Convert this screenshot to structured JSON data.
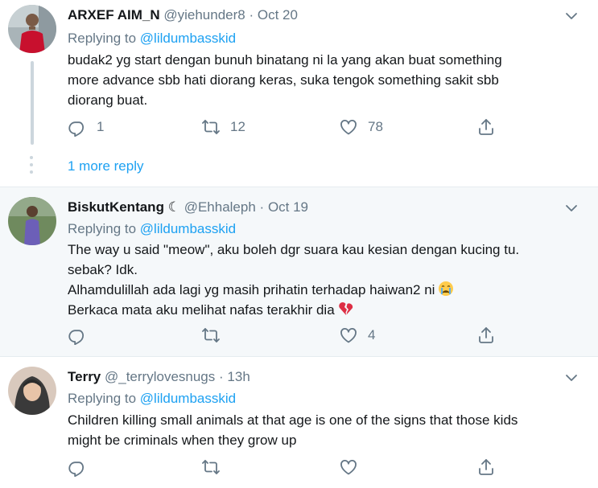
{
  "tweets": [
    {
      "name": "ARXEF AIM_N",
      "handle": "@yiehunder8",
      "sep": "·",
      "date": "Oct 20",
      "replying_prefix": "Replying to",
      "replying_to": "@lildumbasskid",
      "lines": [
        "budak2 yg start dengan bunuh binatang ni la yang akan buat something",
        "more advance sbb hati diorang keras, suka tengok something sakit sbb",
        "diorang buat."
      ],
      "replies": "1",
      "retweets": "12",
      "likes": "78",
      "more_replies": "1 more reply"
    },
    {
      "name": "BiskutKentang",
      "name_suffix": "☾",
      "handle": "@Ehhaleph",
      "sep": "·",
      "date": "Oct 19",
      "replying_prefix": "Replying to",
      "replying_to": "@lildumbasskid",
      "lines": [
        "The way u said \"meow\", aku boleh dgr suara kau kesian dengan kucing tu.",
        "sebak? Idk.",
        "Alhamdulillah ada lagi yg masih prihatin terhadap haiwan2 ni",
        "Berkaca mata aku melihat nafas terakhir dia"
      ],
      "emoji_crying": "crying-face-emoji",
      "emoji_broken_heart": "broken-heart-emoji",
      "replies": "",
      "retweets": "",
      "likes": "4"
    },
    {
      "name": "Terry",
      "handle": "@_terrylovesnugs",
      "sep": "·",
      "date": "13h",
      "replying_prefix": "Replying to",
      "replying_to": "@lildumbasskid",
      "lines": [
        "Children killing small animals at that age is one of the signs that those kids",
        "might be criminals when they grow up"
      ],
      "replies": "",
      "retweets": "",
      "likes": ""
    }
  ],
  "icons": {
    "reply": "reply-icon",
    "retweet": "retweet-icon",
    "like": "heart-icon",
    "share": "share-icon",
    "menu": "chevron-down-icon"
  },
  "colors": {
    "accent": "#1da1f2",
    "muted": "#657786",
    "text": "#14171a",
    "highlight_bg": "#f5f8fa",
    "divider": "#e6ecf0"
  }
}
